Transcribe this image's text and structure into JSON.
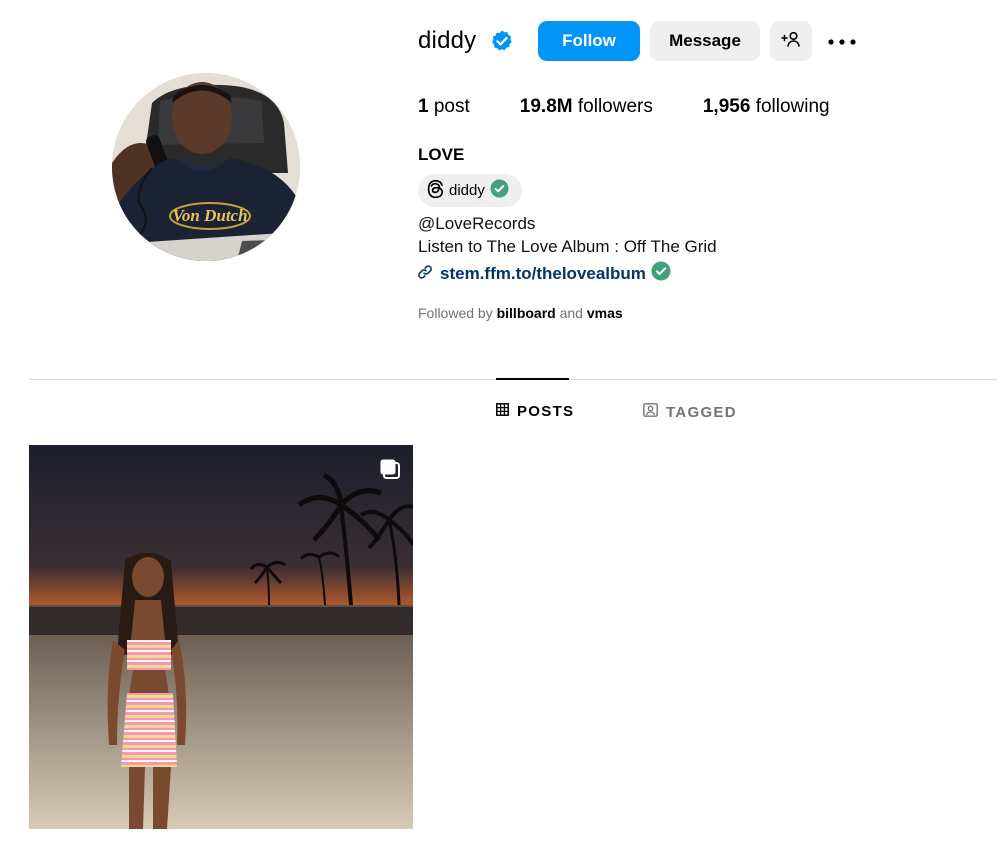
{
  "profile": {
    "username": "diddy",
    "verified": true
  },
  "actions": {
    "follow_label": "Follow",
    "message_label": "Message"
  },
  "stats": {
    "posts_count": "1",
    "posts_label": "post",
    "followers_count": "19.8M",
    "followers_label": "followers",
    "following_count": "1,956",
    "following_label": "following"
  },
  "bio": {
    "name": "LOVE",
    "threads_handle": "diddy",
    "line1": "@LoveRecords",
    "line2": "Listen to The Love Album : Off The Grid",
    "link": "stem.ffm.to/thelovealbum"
  },
  "followed_by": {
    "prefix": "Followed by",
    "user1": "billboard",
    "conjunction": "and",
    "user2": "vmas"
  },
  "tabs": [
    {
      "label": "POSTS",
      "active": true
    },
    {
      "label": "TAGGED",
      "active": false
    }
  ],
  "avatar": {
    "shirt_text": "Von Dutch"
  },
  "colors": {
    "accent": "#0095f6",
    "verified_badge": "#0095f6",
    "link": "#00376b",
    "link_verified": "#3fa27a"
  },
  "icons": [
    "verified-badge-icon",
    "add-user-icon",
    "more-options-icon",
    "threads-icon",
    "chain-link-icon",
    "grid-icon",
    "tagged-icon",
    "multi-image-icon"
  ]
}
